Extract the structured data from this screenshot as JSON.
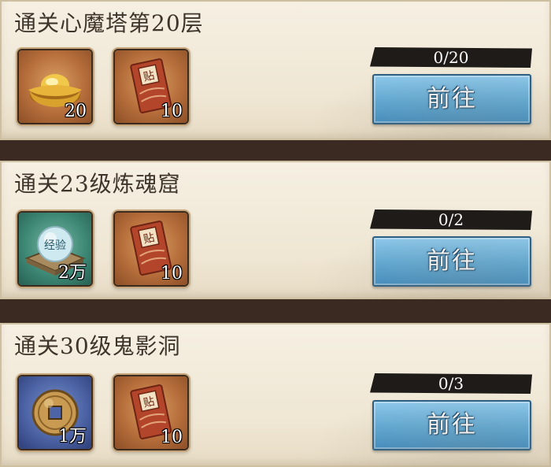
{
  "tasks": [
    {
      "title": "通关心魔塔第20层",
      "rewards": [
        {
          "icon": "gold-ingot-icon",
          "count": "20"
        },
        {
          "icon": "red-envelope-icon",
          "count": "10"
        }
      ],
      "progress": "0/20",
      "button_label": "前往"
    },
    {
      "title": "通关23级炼魂窟",
      "rewards": [
        {
          "icon": "experience-orb-icon",
          "count": "2万",
          "orb_text": "经验"
        },
        {
          "icon": "red-envelope-icon",
          "count": "10"
        }
      ],
      "progress": "0/2",
      "button_label": "前往"
    },
    {
      "title": "通关30级鬼影洞",
      "rewards": [
        {
          "icon": "copper-coin-icon",
          "count": "1万"
        },
        {
          "icon": "red-envelope-icon",
          "count": "10"
        }
      ],
      "progress": "0/3",
      "button_label": "前往"
    }
  ],
  "colors": {
    "card_bg": "#f3ecdc",
    "divider": "#3a2a22",
    "button_blue": "#5ea9d6",
    "progress_bar": "#1f1b18"
  }
}
